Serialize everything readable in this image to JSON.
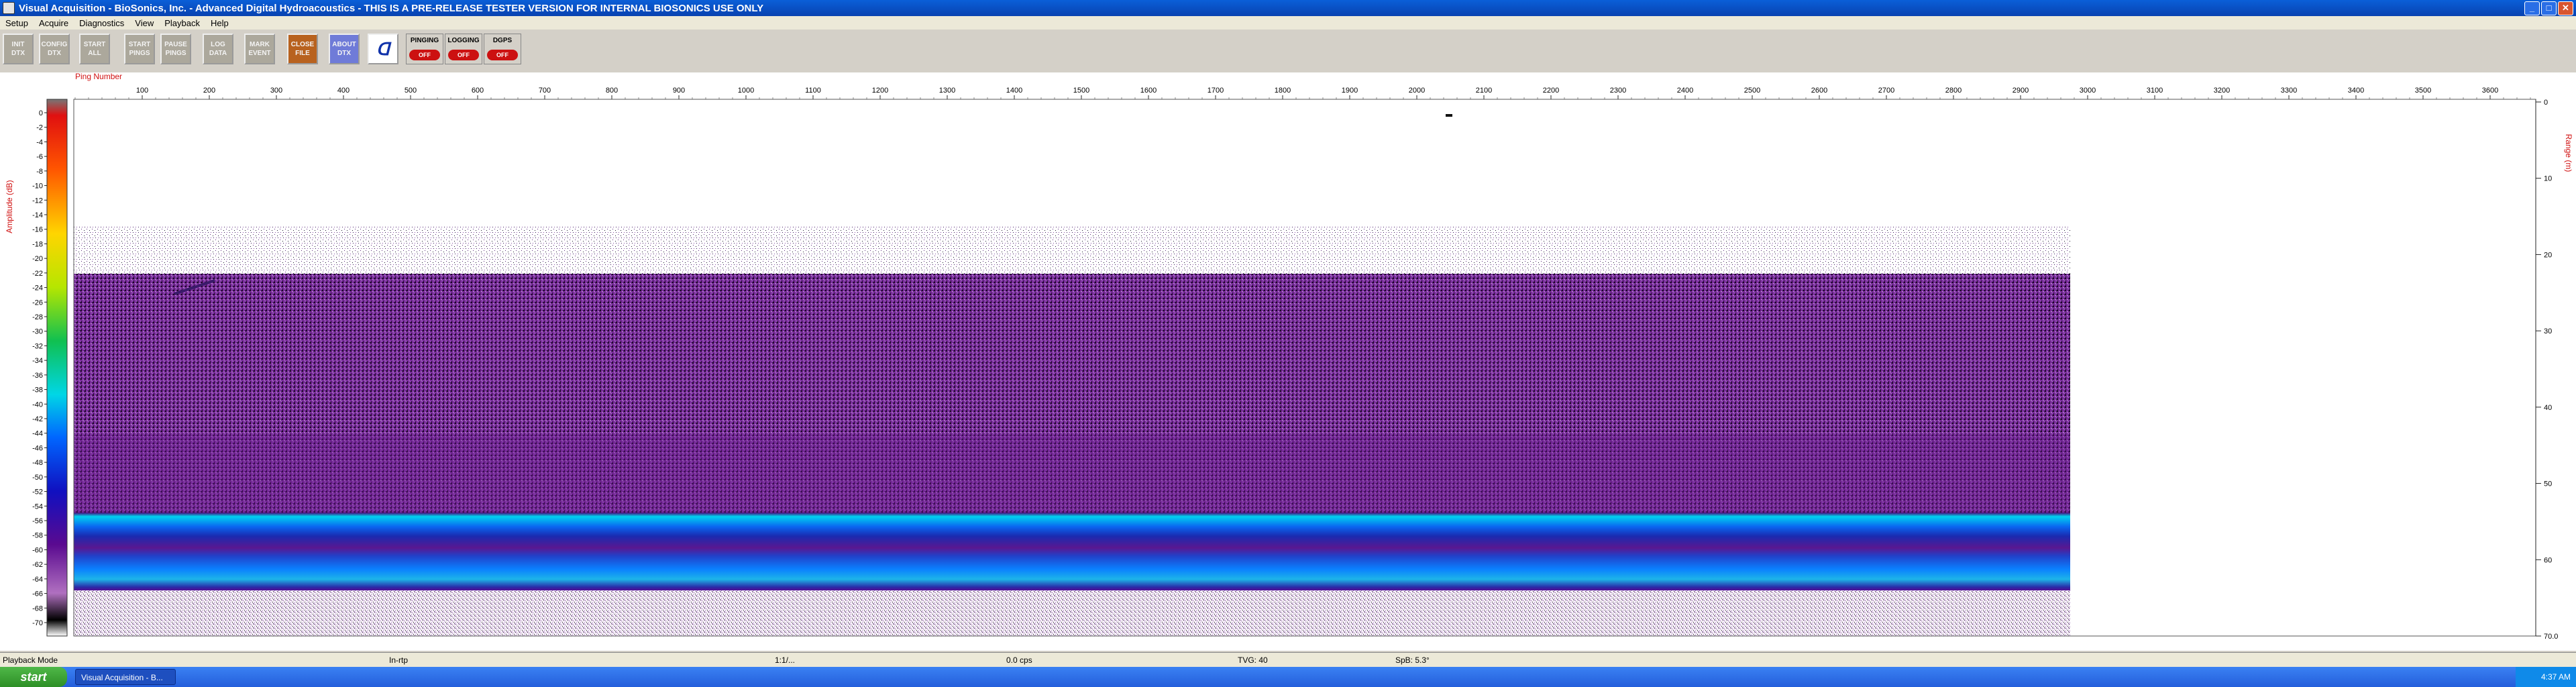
{
  "window": {
    "title": "Visual Acquisition  -  BioSonics, Inc.  -  Advanced Digital Hydroacoustics  -  THIS IS A PRE-RELEASE TESTER VERSION FOR INTERNAL BIOSONICS USE ONLY"
  },
  "menu": [
    "Setup",
    "Acquire",
    "Diagnostics",
    "View",
    "Playback",
    "Help"
  ],
  "toolbar": {
    "buttons": [
      {
        "label": "INIT\nDTX",
        "style": "grey"
      },
      {
        "label": "CONFIG\nDTX",
        "style": "grey"
      },
      {
        "label": "START\nALL",
        "style": "grey"
      },
      {
        "label": "START\nPINGS",
        "style": "grey"
      },
      {
        "label": "PAUSE\nPINGS",
        "style": "grey"
      },
      {
        "label": "LOG\nDATA",
        "style": "grey"
      },
      {
        "label": "MARK\nEVENT",
        "style": "grey"
      },
      {
        "label": "CLOSE\nFILE",
        "style": "close"
      },
      {
        "label": "ABOUT\nDTX",
        "style": "about"
      }
    ],
    "indicators": [
      {
        "label": "PINGING",
        "state": "OFF"
      },
      {
        "label": "LOGGING",
        "state": "OFF"
      },
      {
        "label": "DGPS",
        "state": "OFF"
      }
    ]
  },
  "plot": {
    "x_axis_title": "Ping Number",
    "x_ticks": [
      100,
      200,
      300,
      400,
      500,
      600,
      700,
      800,
      900,
      1000,
      1100,
      1200,
      1300,
      1400,
      1500,
      1600,
      1700,
      1800,
      1900,
      2000,
      2100,
      2200,
      2300,
      2400,
      2500,
      2600,
      2700,
      2800,
      2900,
      3000,
      3100,
      3200,
      3300,
      3400,
      3500,
      3600
    ],
    "amplitude_axis_title": "Amplitude (dB)",
    "amplitude_ticks": [
      0,
      -2,
      -4,
      -6,
      -8,
      -10,
      -12,
      -14,
      -16,
      -18,
      -20,
      -22,
      -24,
      -26,
      -28,
      -30,
      -32,
      -34,
      -36,
      -38,
      -40,
      -42,
      -44,
      -46,
      -48,
      -50,
      -52,
      -54,
      -56,
      -58,
      -60,
      -62,
      -64,
      -66,
      -68,
      -70
    ],
    "range_axis_title": "Range (m)",
    "range_ticks": [
      "0",
      "10",
      "20",
      "30",
      "40",
      "50",
      "60",
      "70.0"
    ]
  },
  "status": {
    "fields": [
      "Playback Mode",
      "In-rtp",
      "1:1/...",
      "0.0 cps",
      "TVG: 40",
      "SpB: 5.3°"
    ]
  },
  "taskbar": {
    "start": "start",
    "task": "Visual Acquisition  -  B...",
    "clock": "4:37 AM"
  }
}
